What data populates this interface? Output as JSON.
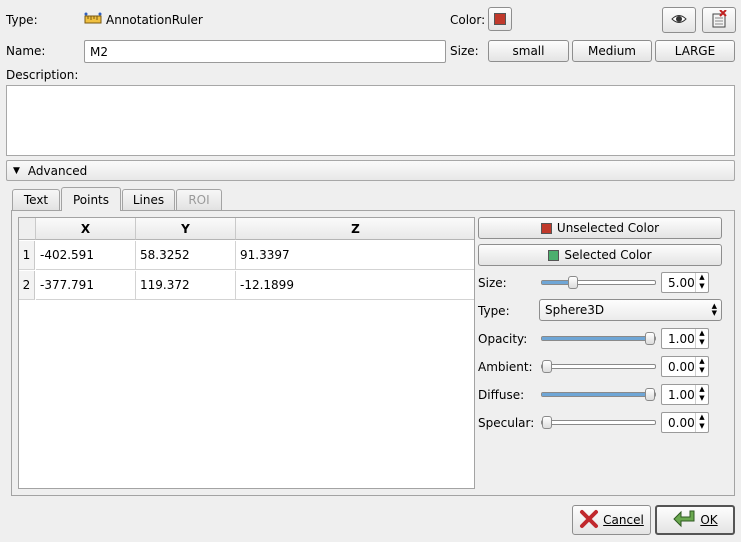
{
  "header": {
    "type_label": "Type:",
    "type_value": "AnnotationRuler",
    "color_label": "Color:",
    "color_swatch": "#c0392b",
    "name_label": "Name:",
    "name_value": "M2",
    "size_label": "Size:",
    "size_buttons": [
      "small",
      "Medium",
      "LARGE"
    ],
    "description_label": "Description:",
    "description_value": ""
  },
  "icons": {
    "type_icon": "ruler-icon",
    "visibility_icon": "eye-icon",
    "lock_icon": "lock-icon"
  },
  "advanced": {
    "label": "Advanced",
    "expanded": true
  },
  "tabs": [
    {
      "label": "Text",
      "active": false,
      "enabled": true
    },
    {
      "label": "Points",
      "active": true,
      "enabled": true
    },
    {
      "label": "Lines",
      "active": false,
      "enabled": true
    },
    {
      "label": "ROI",
      "active": false,
      "enabled": false
    }
  ],
  "points_table": {
    "columns": [
      "X",
      "Y",
      "Z"
    ],
    "rows": [
      {
        "index": "1",
        "x": "-402.591",
        "y": "58.3252",
        "z": "91.3397"
      },
      {
        "index": "2",
        "x": "-377.791",
        "y": "119.372",
        "z": "-12.1899"
      }
    ]
  },
  "point_props": {
    "unselected_color_label": "Unselected Color",
    "unselected_color": "#c0392b",
    "selected_color_label": "Selected Color",
    "selected_color": "#4caf6e",
    "size_label": "Size:",
    "size_value": "5.00",
    "size_fraction": 0.25,
    "type_label": "Type:",
    "type_value": "Sphere3D",
    "opacity_label": "Opacity:",
    "opacity_value": "1.00",
    "opacity_fraction": 1.0,
    "ambient_label": "Ambient:",
    "ambient_value": "0.00",
    "ambient_fraction": 0.0,
    "diffuse_label": "Diffuse:",
    "diffuse_value": "1.00",
    "diffuse_fraction": 1.0,
    "specular_label": "Specular:",
    "specular_value": "0.00",
    "specular_fraction": 0.0
  },
  "footer": {
    "cancel_label": "Cancel",
    "ok_label": "OK"
  }
}
